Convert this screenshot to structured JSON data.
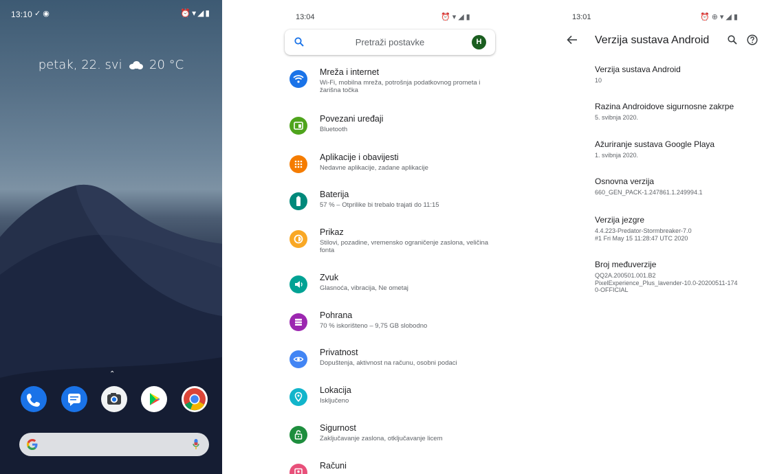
{
  "home": {
    "status_time": "13:10",
    "glance_text": "petak, 22. svi",
    "temperature": "20 °C",
    "dock_apps": [
      "phone-icon",
      "messages-icon",
      "camera-icon",
      "play-store-icon",
      "chrome-icon"
    ],
    "search_logo": "G"
  },
  "settings": {
    "status_time": "13:04",
    "search_placeholder": "Pretraži postavke",
    "avatar_letter": "H",
    "items": [
      {
        "title": "Mreža i internet",
        "sub": "Wi-Fi, mobilna mreža, potrošnja podatkovnog prometa i žarišna točka",
        "color": "#1a73e8",
        "icon": "wifi-icon"
      },
      {
        "title": "Povezani uređaji",
        "sub": "Bluetooth",
        "color": "#4ea41c",
        "icon": "devices-icon"
      },
      {
        "title": "Aplikacije i obavijesti",
        "sub": "Nedavne aplikacije, zadane aplikacije",
        "color": "#f57c00",
        "icon": "apps-icon"
      },
      {
        "title": "Baterija",
        "sub": "57 % – Otprilike bi trebalo trajati do 11:15",
        "color": "#00897b",
        "icon": "battery-icon"
      },
      {
        "title": "Prikaz",
        "sub": "Stilovi, pozadine, vremensko ograničenje zaslona, veličina fonta",
        "color": "#f9a825",
        "icon": "display-icon"
      },
      {
        "title": "Zvuk",
        "sub": "Glasnoća, vibracija, Ne ometaj",
        "color": "#00a294",
        "icon": "sound-icon"
      },
      {
        "title": "Pohrana",
        "sub": "70 % iskorišteno – 9,75 GB slobodno",
        "color": "#9c27b0",
        "icon": "storage-icon"
      },
      {
        "title": "Privatnost",
        "sub": "Dopuštenja, aktivnost na računu, osobni podaci",
        "color": "#4285f4",
        "icon": "privacy-icon"
      },
      {
        "title": "Lokacija",
        "sub": "Isključeno",
        "color": "#12b5cb",
        "icon": "location-icon"
      },
      {
        "title": "Sigurnost",
        "sub": "Zaključavanje zaslona, otključavanje licem",
        "color": "#1e8e3e",
        "icon": "lock-icon"
      },
      {
        "title": "Računi",
        "sub": "",
        "color": "#e8507a",
        "icon": "accounts-icon"
      }
    ]
  },
  "version": {
    "status_time": "13:01",
    "title": "Verzija sustava Android",
    "items": [
      {
        "title": "Verzija sustava Android",
        "lines": [
          "10"
        ]
      },
      {
        "title": "Razina Androidove sigurnosne zakrpe",
        "lines": [
          "5. svibnja 2020."
        ]
      },
      {
        "title": "Ažuriranje sustava Google Playa",
        "lines": [
          "1. svibnja 2020."
        ]
      },
      {
        "title": "Osnovna verzija",
        "lines": [
          "660_GEN_PACK-1.247861.1.249994.1"
        ]
      },
      {
        "title": "Verzija jezgre",
        "lines": [
          "4.4.223-Predator-Stormbreaker-7.0",
          "#1 Fri May 15 11:28:47 UTC 2020"
        ]
      },
      {
        "title": "Broj međuverzije",
        "lines": [
          "QQ2A.200501.001.B2",
          "PixelExperience_Plus_lavender-10.0-20200511-174",
          "0-OFFICIAL"
        ]
      }
    ]
  }
}
